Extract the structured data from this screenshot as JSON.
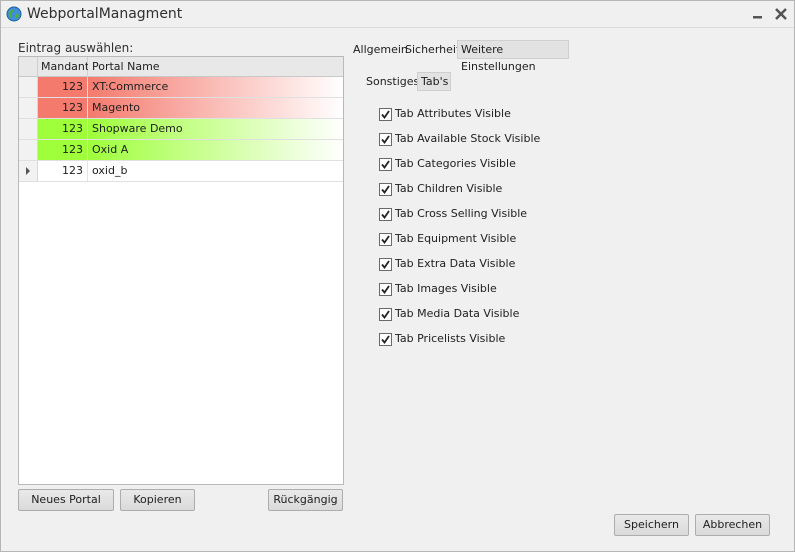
{
  "window": {
    "title": "WebportalManagment"
  },
  "left": {
    "select_label": "Eintrag auswählen:",
    "columns": [
      "Mandant",
      "Portal Name"
    ],
    "rows": [
      {
        "mandant": "123",
        "portal": "XT:Commerce",
        "status_color": "#f47a6e"
      },
      {
        "mandant": "123",
        "portal": "Magento",
        "status_color": "#f47a6e"
      },
      {
        "mandant": "123",
        "portal": "Shopware Demo",
        "status_color": "#9eff3a"
      },
      {
        "mandant": "123",
        "portal": "Oxid A",
        "status_color": "#9eff3a"
      },
      {
        "mandant": "123",
        "portal": "oxid_b",
        "status_color": "#ffffff"
      }
    ],
    "buttons": {
      "new": "Neues Portal",
      "copy": "Kopieren",
      "undo": "Rückgängig"
    }
  },
  "right": {
    "tabs": [
      "Allgemein",
      "Sicherheit",
      "Weitere Einstellungen"
    ],
    "subtabs": [
      "Sonstiges",
      "Tab's"
    ],
    "checkboxes": [
      {
        "label": "Tab Attributes Visible",
        "checked": true
      },
      {
        "label": "Tab Available Stock Visible",
        "checked": true
      },
      {
        "label": "Tab Categories Visible",
        "checked": true
      },
      {
        "label": "Tab Children Visible",
        "checked": true
      },
      {
        "label": "Tab Cross Selling Visible",
        "checked": true
      },
      {
        "label": "Tab Equipment Visible",
        "checked": true
      },
      {
        "label": "Tab Extra Data Visible",
        "checked": true
      },
      {
        "label": "Tab Images Visible",
        "checked": true
      },
      {
        "label": "Tab Media Data Visible",
        "checked": true
      },
      {
        "label": "Tab Pricelists Visible",
        "checked": true
      }
    ]
  },
  "footer": {
    "save": "Speichern",
    "cancel": "Abbrechen"
  }
}
